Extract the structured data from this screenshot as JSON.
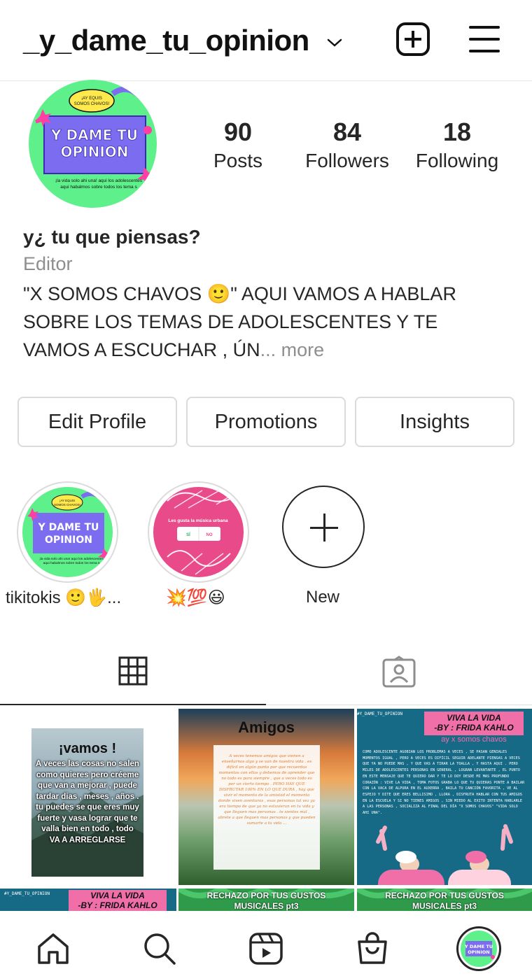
{
  "header": {
    "username": "_y_dame_tu_opinion"
  },
  "profile": {
    "avatar_title_line1": "Y DAME TU",
    "avatar_title_line2": "OPINION",
    "avatar_bubble": "¡AY EQUIS SOMOS CHAVOS!",
    "avatar_caption": "¡la vida solo ahi una! aqui los adolescentes aqui habalmos sobre todos los tema s",
    "stats": [
      {
        "value": "90",
        "label": "Posts"
      },
      {
        "value": "84",
        "label": "Followers"
      },
      {
        "value": "18",
        "label": "Following"
      }
    ],
    "name": "y¿ tu que piensas?",
    "category": "Editor",
    "bio_line1": "\"X SOMOS CHAVOS 🙂\" AQUI VAMOS A HABLAR",
    "bio_line2": "SOBRE LOS TEMAS DE ADOLESCENTES Y TE",
    "bio_line3": "VAMOS A ESCUCHAR , ÚN",
    "bio_ellipsis": "...",
    "bio_more": "more"
  },
  "buttons": {
    "edit": "Edit Profile",
    "promotions": "Promotions",
    "insights": "Insights"
  },
  "highlights": [
    {
      "label": "tikitokis 🙂🖐..."
    },
    {
      "label": "💥💯😃",
      "title": "Les gusta la música urbana",
      "yes": "SÍ",
      "no": "NO"
    },
    {
      "label": "New"
    }
  ],
  "posts": {
    "p1": {
      "title": "¡vamos !",
      "text": "A veces las cosas no salen como quieres pero créeme que van a mejorar , puede tardar dias , meses , años . tu puedes se que eres muy fuerte y vasa lograr que te valla bien en todo , todo VA A ARREGLARSE"
    },
    "p2": {
      "title": "Amigos",
      "text": "A veces tenemos amigos que vienen a enseñarnos algo y se van de nuestra vida . es difícil en algún punto por que recuerdas momentos con ellos y debemos de aprender que no todo es para siempre , que a veces todo es por un cierto tiempo . PERO HAY QUE DISFRUTAR 100% EN LO QUE DURA , hay que vivir el momento de la amistad el momento donde viven aventuras , esas personas tal vez ya era tiempo de que ya no estuvieran en tu vida y que lleguen mas personas . te sientes mal , abrete a que lleguen mas personas y que pueden sumarte a tu vida ..."
    },
    "p3": {
      "tag": "#Y_DAME_TU_OPINION",
      "title1": "VIVA LA VIDA",
      "title2": "-BY : FRIDA KAHLO",
      "subtitle": "ay x somos chavos",
      "text": "COMO ADOLESCENTE AGOBIAN LOS PROBLEMAS A VECES , SE PASAN GENIALES MOMENTOS IGUAL , PERO A VECES ES DIFÍCIL SEGUIR ADELANTE PIENSAS A VECES QUE YA NO PUEDE MAS , Y QUE VAS A TIRAR LA TOALLA , Y HASTA AQUI . PERO MILES DE ADOLESCENTES PERSONAS EN GENERAL , LOGRAN LEVANTARTE , EL PUNTO EN ESTE MENSAJE QUE TE QUIERO DAR Y TE LO DOY DESDE MI MAS PROFUNDO CORAZÓN : VIVE LA VIDA , TOMA FOTOS GRABA LO QUE TU QUIERAS PONTE A BAILAR CON LA VACA DE ALPURA EN EL AUXERRA , BAILA TU CANCIÓN FAVORITA , VE AL ESPEJO Y DITE QUE ERES BELLISIMO , LLORA , DISFRUTA HABLAR CON TUS AMIGOS EN LA ESCUELA Y SI NO TIENES AMIGOS , SIN MIEDO AL EXITO INTENTA HABLARLE A LAS PERSONAS , SOCIALIZA AL FINAL DEL DÍA \"X SOMOS CHAVOS\" \"VIDA SOLO AHI UNA\"."
    },
    "p4": {
      "tag": "#Y_DAME_TU_OPINION",
      "title1": "VIVA LA VIDA",
      "title2": "-BY : FRIDA KAHLO"
    },
    "p5": {
      "line1": "RECHAZO POR TUS GUSTOS",
      "line2": "MUSICALES  pt3"
    },
    "p6": {
      "line1": "RECHAZO POR TUS GUSTOS",
      "line2": "MUSICALES  pt3"
    }
  },
  "colors": {
    "brand_purple": "#7b6cf0",
    "brand_green": "#5ef08a",
    "text_dark": "#262626",
    "muted": "#8e8e8e",
    "border": "#dbdbdb",
    "frida_pink": "#f06fa8",
    "teal_post": "#176a86"
  },
  "icons": {
    "header": [
      "chevron-down-icon",
      "new-post-icon",
      "menu-icon"
    ],
    "tabs": [
      "grid-icon",
      "tagged-icon"
    ],
    "nav": [
      "home-icon",
      "search-icon",
      "reels-icon",
      "shop-icon",
      "profile-avatar"
    ]
  }
}
